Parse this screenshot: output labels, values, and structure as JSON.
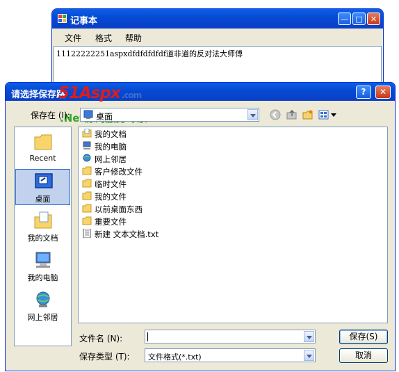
{
  "notepad": {
    "title": "记事本",
    "menu": [
      "文件",
      "格式",
      "帮助"
    ],
    "content": "11122222251aspxdfdfdfdfdf道非道的反对法大师傅",
    "controls": {
      "minimize": "—",
      "maximize": "□",
      "close": "✕"
    }
  },
  "dialog": {
    "title": "请选择保存路",
    "help": "?",
    "close": "✕",
    "watermark": {
      "brand": "51Aspx",
      "domain": ".com",
      "tagline": ".Net源码服务专家"
    },
    "save_in_label": "保存在 (I):",
    "save_in_value": "桌面",
    "places": [
      {
        "label": "Recent",
        "icon": "recent-folder-icon"
      },
      {
        "label": "桌面",
        "icon": "desktop-icon"
      },
      {
        "label": "我的文档",
        "icon": "my-documents-icon"
      },
      {
        "label": "我的电脑",
        "icon": "my-computer-icon"
      },
      {
        "label": "网上邻居",
        "icon": "network-places-icon"
      }
    ],
    "files": [
      {
        "name": "我的文档",
        "icon": "my-documents-icon"
      },
      {
        "name": "我的电脑",
        "icon": "my-computer-icon"
      },
      {
        "name": "网上邻居",
        "icon": "network-places-icon"
      },
      {
        "name": "客户修改文件",
        "icon": "folder-icon"
      },
      {
        "name": "临时文件",
        "icon": "folder-icon"
      },
      {
        "name": "我的文件",
        "icon": "folder-icon"
      },
      {
        "name": "以前桌面东西",
        "icon": "folder-icon"
      },
      {
        "name": "重要文件",
        "icon": "folder-icon"
      },
      {
        "name": "新建 文本文档.txt",
        "icon": "text-file-icon"
      }
    ],
    "filename_label": "文件名 (N):",
    "filename_value": "",
    "filetype_label": "保存类型 (T):",
    "filetype_value": "文件格式(*.txt)",
    "save_button": "保存(S)",
    "cancel_button": "取消"
  }
}
